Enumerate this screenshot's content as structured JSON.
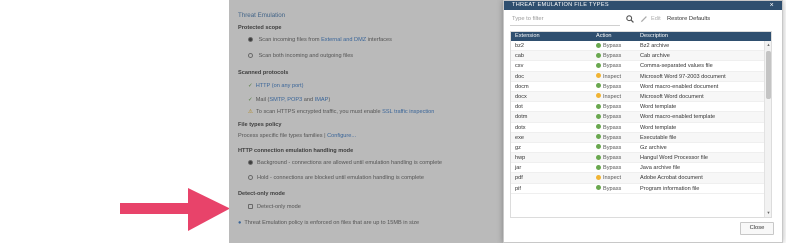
{
  "background_panel": {
    "title": "Threat Emulation",
    "protected_scope_heading": "Protected scope",
    "scope_option_1_prefix": "Scan incoming files from",
    "scope_option_1_link": "External and DMZ",
    "scope_option_1_suffix": "interfaces",
    "scope_option_2": "Scan both incoming and outgoing files",
    "scanned_protocols_heading": "Scanned protocols",
    "protocol_http": "HTTP (on any port)",
    "protocol_mail_prefix": "Mail (",
    "protocol_mail_link1": "SMTP, POP3",
    "protocol_mail_and": "and",
    "protocol_mail_link2": "IMAP",
    "protocol_mail_suffix": ")",
    "https_note_prefix": "To scan HTTPS encrypted traffic, you must enable",
    "https_note_link": "SSL traffic inspection",
    "file_types_heading": "File types policy",
    "file_types_text": "Process specific file types families |",
    "file_types_link": "Configure...",
    "http_mode_heading": "HTTP connection emulation handling mode",
    "http_mode_option_1": "Background - connections are allowed until emulation handling is complete",
    "http_mode_option_2": "Hold - connections are blocked until emulation handling is complete",
    "detect_heading": "Detect-only mode",
    "detect_option": "Detect-only mode",
    "footer_info": "Threat Emulation policy is enforced on files that are up to 15MB in size"
  },
  "dialog": {
    "title": "THREAT EMULATION FILE TYPES",
    "close_glyph": "×",
    "search_placeholder": "Type to filter",
    "edit_label": "Edit",
    "restore_label": "Restore Defaults",
    "columns": {
      "extension": "Extension",
      "action": "Action",
      "description": "Description"
    },
    "rows": [
      {
        "ext": "bz2",
        "action": "Bypass",
        "desc": "Bz2 archive"
      },
      {
        "ext": "cab",
        "action": "Bypass",
        "desc": "Cab archive"
      },
      {
        "ext": "csv",
        "action": "Bypass",
        "desc": "Comma-separated values file"
      },
      {
        "ext": "doc",
        "action": "Inspect",
        "desc": "Microsoft Word 97-2003 document"
      },
      {
        "ext": "docm",
        "action": "Bypass",
        "desc": "Word macro-enabled document"
      },
      {
        "ext": "docx",
        "action": "Inspect",
        "desc": "Microsoft Word document"
      },
      {
        "ext": "dot",
        "action": "Bypass",
        "desc": "Word template"
      },
      {
        "ext": "dotm",
        "action": "Bypass",
        "desc": "Word macro-enabled template"
      },
      {
        "ext": "dotx",
        "action": "Bypass",
        "desc": "Word template"
      },
      {
        "ext": "exe",
        "action": "Bypass",
        "desc": "Executable file"
      },
      {
        "ext": "gz",
        "action": "Bypass",
        "desc": "Gz archive"
      },
      {
        "ext": "hwp",
        "action": "Bypass",
        "desc": "Hangul Word Processor file"
      },
      {
        "ext": "jar",
        "action": "Bypass",
        "desc": "Java archive file"
      },
      {
        "ext": "pdf",
        "action": "Inspect",
        "desc": "Adobe Acrobat document"
      },
      {
        "ext": "pif",
        "action": "Bypass",
        "desc": "Program information file"
      }
    ],
    "close_button": "Close"
  },
  "colors": {
    "header_bg": "#2f4f6f",
    "bypass": "#6aa84f",
    "inspect": "#f1b434",
    "arrow": "#e8436a"
  }
}
